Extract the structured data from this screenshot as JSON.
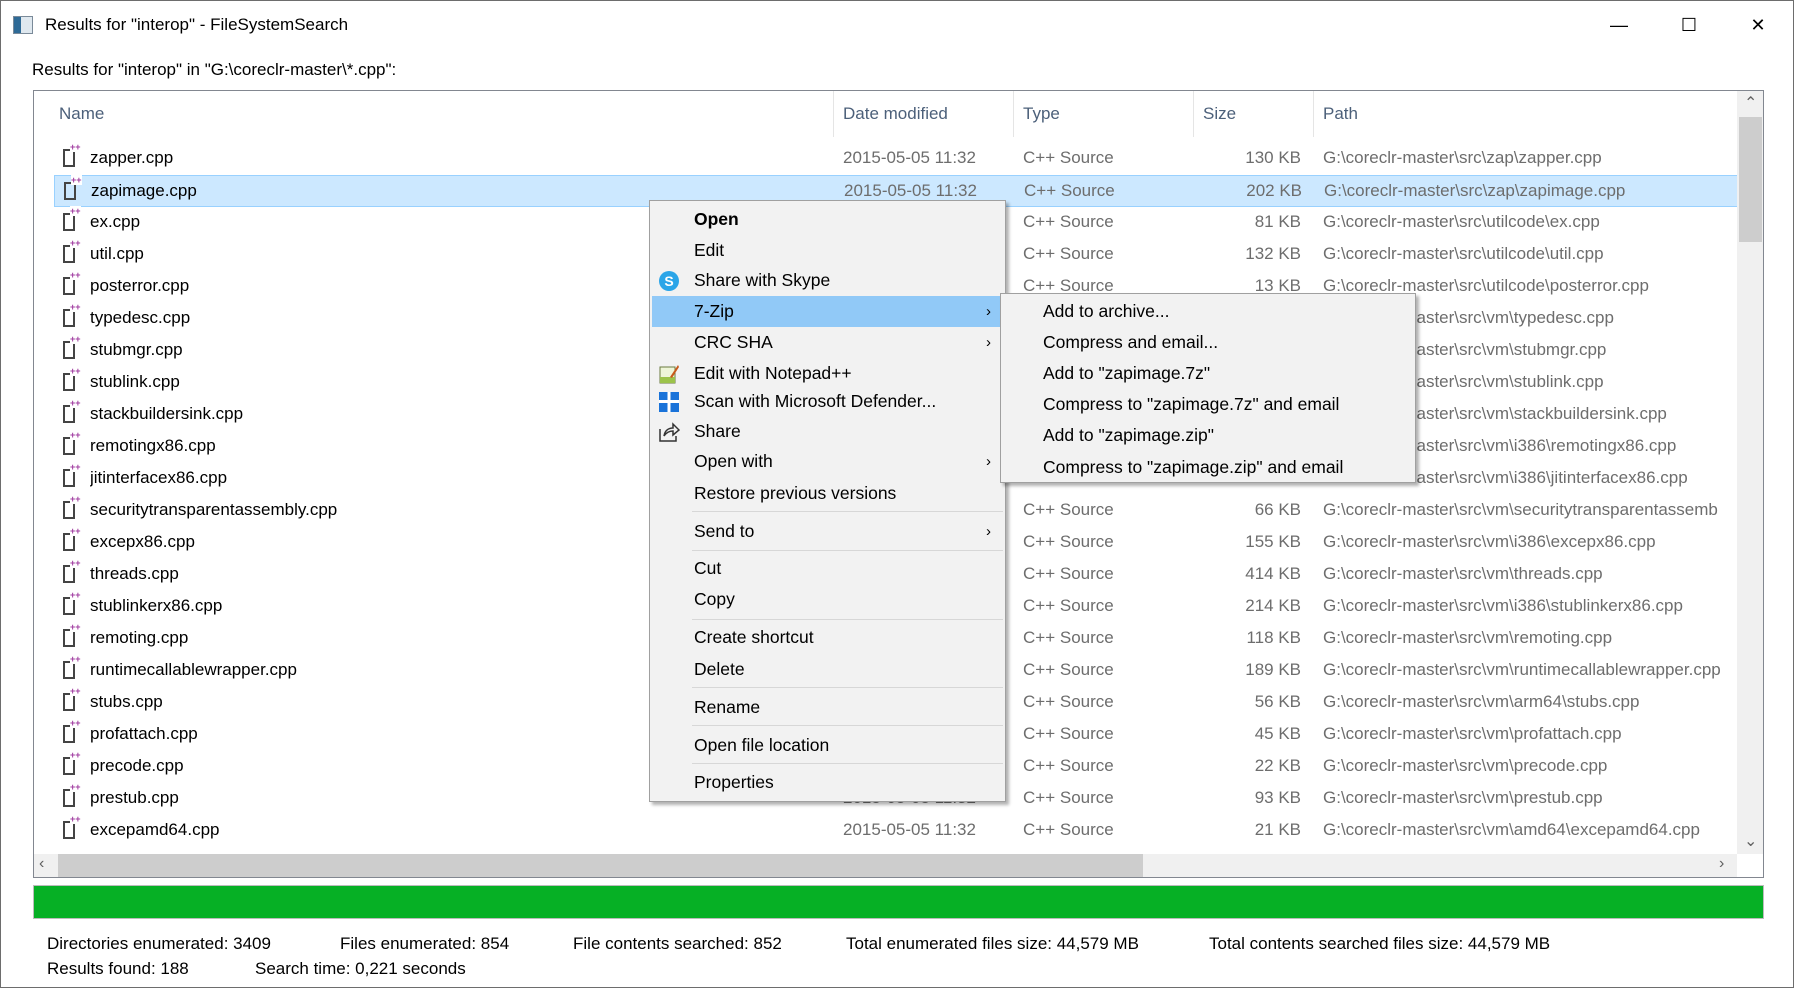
{
  "window": {
    "title": "Results for \"interop\" - FileSystemSearch",
    "minimize": "—",
    "maximize": "☐",
    "close": "✕"
  },
  "results_label": "Results for \"interop\" in \"G:\\coreclr-master\\*.cpp\":",
  "columns": [
    "Name",
    "Date modified",
    "Type",
    "Size",
    "Path"
  ],
  "rows": [
    {
      "name": "zapper.cpp",
      "date": "2015-05-05 11:32",
      "type": "C++ Source",
      "size": "130 KB",
      "path": "G:\\coreclr-master\\src\\zap\\zapper.cpp"
    },
    {
      "name": "zapimage.cpp",
      "date": "2015-05-05 11:32",
      "type": "C++ Source",
      "size": "202 KB",
      "path": "G:\\coreclr-master\\src\\zap\\zapimage.cpp",
      "selected": true
    },
    {
      "name": "ex.cpp",
      "date": "",
      "type": "C++ Source",
      "size": "81 KB",
      "path": "G:\\coreclr-master\\src\\utilcode\\ex.cpp"
    },
    {
      "name": "util.cpp",
      "date": "",
      "type": "C++ Source",
      "size": "132 KB",
      "path": "G:\\coreclr-master\\src\\utilcode\\util.cpp"
    },
    {
      "name": "posterror.cpp",
      "date": "",
      "type": "C++ Source",
      "size": "13 KB",
      "path": "G:\\coreclr-master\\src\\utilcode\\posterror.cpp"
    },
    {
      "name": "typedesc.cpp",
      "date": "",
      "type": "",
      "size": "",
      "path": "G:\\coreclr-master\\src\\vm\\typedesc.cpp"
    },
    {
      "name": "stubmgr.cpp",
      "date": "",
      "type": "",
      "size": "",
      "path": "G:\\coreclr-master\\src\\vm\\stubmgr.cpp"
    },
    {
      "name": "stublink.cpp",
      "date": "",
      "type": "",
      "size": "",
      "path": "G:\\coreclr-master\\src\\vm\\stublink.cpp"
    },
    {
      "name": "stackbuildersink.cpp",
      "date": "",
      "type": "",
      "size": "",
      "path": "G:\\coreclr-master\\src\\vm\\stackbuildersink.cpp"
    },
    {
      "name": "remotingx86.cpp",
      "date": "",
      "type": "",
      "size": "",
      "path": "G:\\coreclr-master\\src\\vm\\i386\\remotingx86.cpp"
    },
    {
      "name": "jitinterfacex86.cpp",
      "date": "",
      "type": "",
      "size": "",
      "path": "G:\\coreclr-master\\src\\vm\\i386\\jitinterfacex86.cpp"
    },
    {
      "name": "securitytransparentassembly.cpp",
      "date": "",
      "type": "C++ Source",
      "size": "66 KB",
      "path": "G:\\coreclr-master\\src\\vm\\securitytransparentassemb"
    },
    {
      "name": "excepx86.cpp",
      "date": "",
      "type": "C++ Source",
      "size": "155 KB",
      "path": "G:\\coreclr-master\\src\\vm\\i386\\excepx86.cpp"
    },
    {
      "name": "threads.cpp",
      "date": "",
      "type": "C++ Source",
      "size": "414 KB",
      "path": "G:\\coreclr-master\\src\\vm\\threads.cpp"
    },
    {
      "name": "stublinkerx86.cpp",
      "date": "",
      "type": "C++ Source",
      "size": "214 KB",
      "path": "G:\\coreclr-master\\src\\vm\\i386\\stublinkerx86.cpp"
    },
    {
      "name": "remoting.cpp",
      "date": "",
      "type": "C++ Source",
      "size": "118 KB",
      "path": "G:\\coreclr-master\\src\\vm\\remoting.cpp"
    },
    {
      "name": "runtimecallablewrapper.cpp",
      "date": "",
      "type": "C++ Source",
      "size": "189 KB",
      "path": "G:\\coreclr-master\\src\\vm\\runtimecallablewrapper.cpp"
    },
    {
      "name": "stubs.cpp",
      "date": "",
      "type": "C++ Source",
      "size": "56 KB",
      "path": "G:\\coreclr-master\\src\\vm\\arm64\\stubs.cpp"
    },
    {
      "name": "profattach.cpp",
      "date": "",
      "type": "C++ Source",
      "size": "45 KB",
      "path": "G:\\coreclr-master\\src\\vm\\profattach.cpp"
    },
    {
      "name": "precode.cpp",
      "date": "",
      "type": "C++ Source",
      "size": "22 KB",
      "path": "G:\\coreclr-master\\src\\vm\\precode.cpp"
    },
    {
      "name": "prestub.cpp",
      "date": "2015-05-05 11:32",
      "type": "C++ Source",
      "size": "93 KB",
      "path": "G:\\coreclr-master\\src\\vm\\prestub.cpp"
    },
    {
      "name": "excepamd64.cpp",
      "date": "2015-05-05 11:32",
      "type": "C++ Source",
      "size": "21 KB",
      "path": "G:\\coreclr-master\\src\\vm\\amd64\\excepamd64.cpp"
    }
  ],
  "context_menu": {
    "open": "Open",
    "edit": "Edit",
    "skype": "Share with Skype",
    "zip": "7-Zip",
    "crc": "CRC SHA",
    "notepad": "Edit with Notepad++",
    "defender": "Scan with Microsoft Defender...",
    "share": "Share",
    "open_with": "Open with",
    "restore": "Restore previous versions",
    "send_to": "Send to",
    "cut": "Cut",
    "copy": "Copy",
    "shortcut": "Create shortcut",
    "delete": "Delete",
    "rename": "Rename",
    "open_location": "Open file location",
    "properties": "Properties",
    "chevron": "›"
  },
  "zip_submenu": [
    "Add to archive...",
    "Compress and email...",
    "Add to \"zapimage.7z\"",
    "Compress to \"zapimage.7z\" and email",
    "Add to \"zapimage.zip\"",
    "Compress to \"zapimage.zip\" and email"
  ],
  "progress": {
    "percent": 100,
    "color": "#06B025"
  },
  "status": {
    "dirs": "Directories enumerated: 3409",
    "files": "Files enumerated: 854",
    "contents": "File contents searched: 852",
    "total_size": "Total enumerated files size: 44,579 MB",
    "contents_size": "Total contents searched files size: 44,579 MB",
    "results": "Results found: 188",
    "time": "Search time: 0,221 seconds"
  },
  "colors": {
    "selection": "#CCE8FF",
    "menu_highlight": "#91C9F7"
  }
}
